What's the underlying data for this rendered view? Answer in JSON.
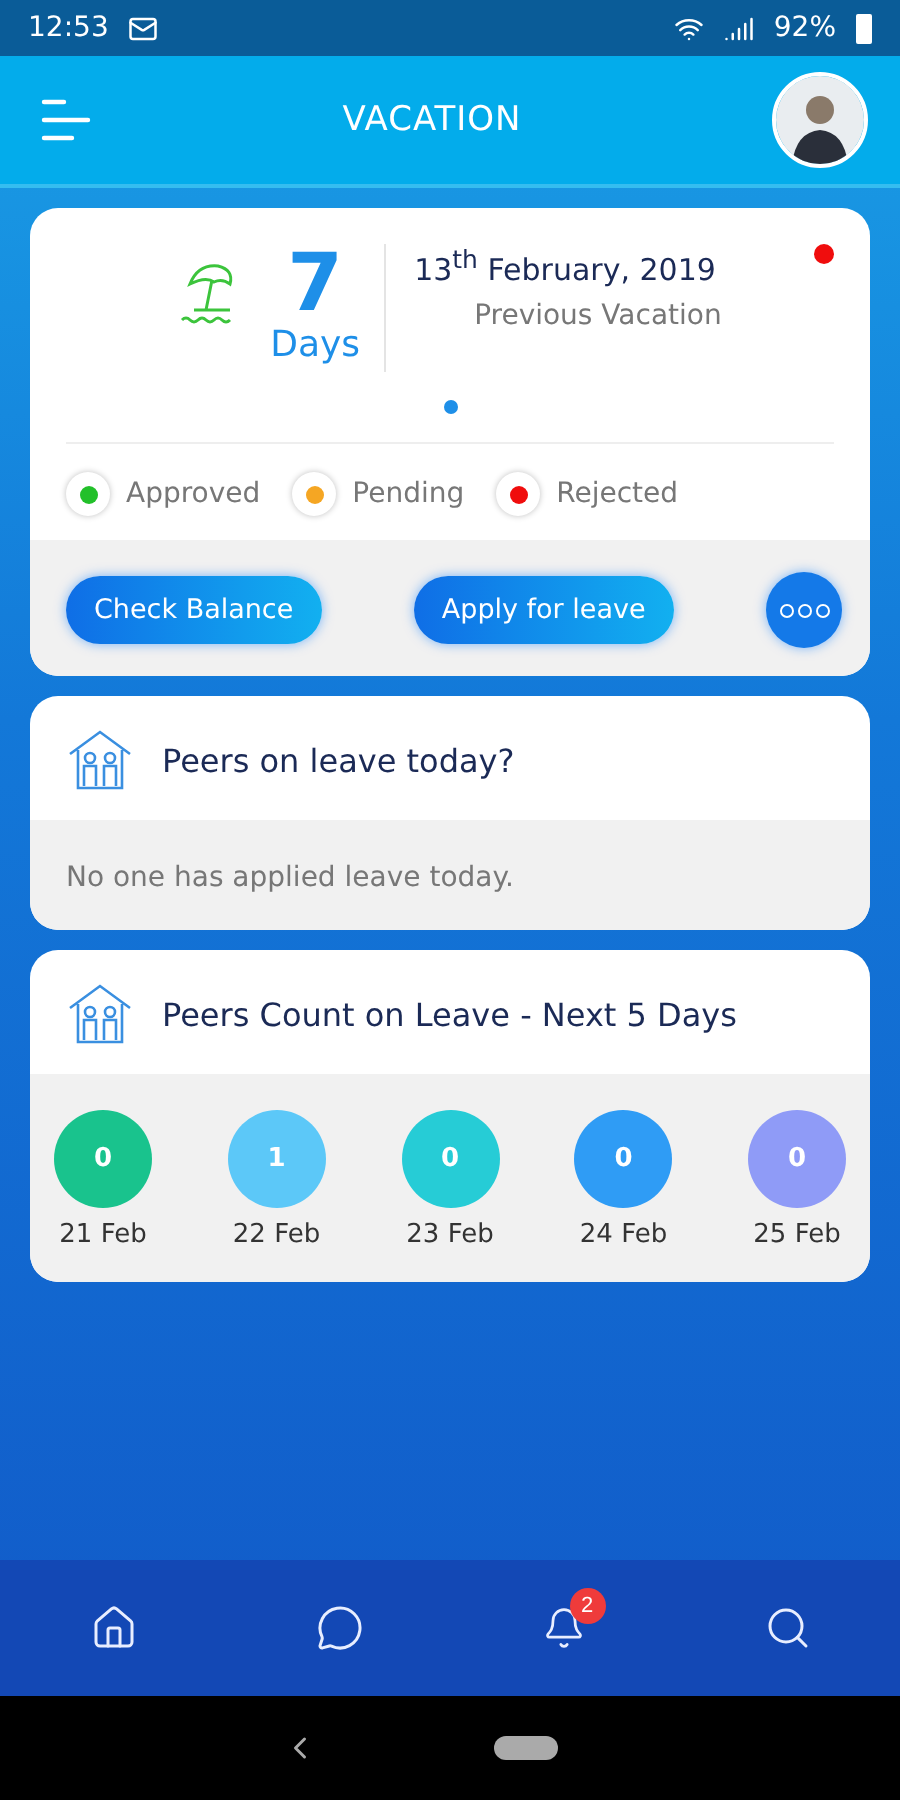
{
  "status_bar": {
    "time": "12:53",
    "battery": "92%"
  },
  "header": {
    "title": "VACATION"
  },
  "vacation_card": {
    "count": "7",
    "unit": "Days",
    "date": "13$^{th}$ February, 2019",
    "caption": "Previous Vacation",
    "legend": [
      {
        "label": "Approved",
        "color": "#22c02a"
      },
      {
        "label": "Pending",
        "color": "#f5a623"
      },
      {
        "label": "Rejected",
        "color": "#f00d0d"
      }
    ],
    "buttons": [
      "Check Balance",
      "Apply for leave"
    ]
  },
  "peers_today": {
    "title": "Peers on leave today?",
    "message": "No one has applied leave today."
  },
  "peers_count": {
    "title": "Peers Count on Leave - Next 5 Days",
    "days": [
      {
        "count": "0",
        "date": "21 Feb",
        "color": "#19c38d"
      },
      {
        "count": "1",
        "date": "22 Feb",
        "color": "#5cc8f8"
      },
      {
        "count": "0",
        "date": "23 Feb",
        "color": "#26ccd6"
      },
      {
        "count": "0",
        "date": "24 Feb",
        "color": "#2f9cf5"
      },
      {
        "count": "0",
        "date": "25 Feb",
        "color": "#8f9bf7"
      }
    ]
  },
  "bottom_nav": {
    "notification_badge": "2"
  }
}
